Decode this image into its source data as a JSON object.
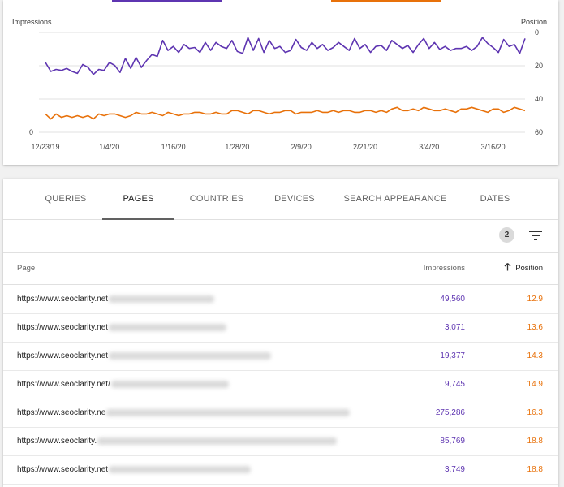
{
  "chart": {
    "left_axis_title": "Impressions",
    "right_axis_title": "Position",
    "left_ticks": [
      "0"
    ],
    "right_ticks": [
      "0",
      "20",
      "40",
      "60"
    ],
    "x_ticks": [
      "12/23/19",
      "1/4/20",
      "1/16/20",
      "1/28/20",
      "2/9/20",
      "2/21/20",
      "3/4/20",
      "3/16/20"
    ],
    "colors": {
      "impressions": "#5e35b1",
      "position": "#e8710a",
      "grid": "#e0e0e0"
    }
  },
  "chart_data": {
    "type": "line",
    "x": [
      "12/23/19",
      "12/24/19",
      "12/25/19",
      "12/26/19",
      "12/27/19",
      "12/28/19",
      "12/29/19",
      "12/30/19",
      "12/31/19",
      "1/1/20",
      "1/2/20",
      "1/3/20",
      "1/4/20",
      "1/5/20",
      "1/6/20",
      "1/7/20",
      "1/8/20",
      "1/9/20",
      "1/10/20",
      "1/11/20",
      "1/12/20",
      "1/13/20",
      "1/14/20",
      "1/15/20",
      "1/16/20",
      "1/17/20",
      "1/18/20",
      "1/19/20",
      "1/20/20",
      "1/21/20",
      "1/22/20",
      "1/23/20",
      "1/24/20",
      "1/25/20",
      "1/26/20",
      "1/27/20",
      "1/28/20",
      "1/29/20",
      "1/30/20",
      "1/31/20",
      "2/1/20",
      "2/2/20",
      "2/3/20",
      "2/4/20",
      "2/5/20",
      "2/6/20",
      "2/7/20",
      "2/8/20",
      "2/9/20",
      "2/10/20",
      "2/11/20",
      "2/12/20",
      "2/13/20",
      "2/14/20",
      "2/15/20",
      "2/16/20",
      "2/17/20",
      "2/18/20",
      "2/19/20",
      "2/20/20",
      "2/21/20",
      "2/22/20",
      "2/23/20",
      "2/24/20",
      "2/25/20",
      "2/26/20",
      "2/27/20",
      "2/28/20",
      "2/29/20",
      "3/1/20",
      "3/2/20",
      "3/3/20",
      "3/4/20",
      "3/5/20",
      "3/6/20",
      "3/7/20",
      "3/8/20",
      "3/9/20",
      "3/10/20",
      "3/11/20",
      "3/12/20",
      "3/13/20",
      "3/14/20",
      "3/15/20",
      "3/16/20",
      "3/17/20",
      "3/18/20",
      "3/19/20",
      "3/20/20",
      "3/21/20",
      "3/22/20"
    ],
    "series": [
      {
        "axis": "left",
        "color": "#5e35b1",
        "values": [
          70,
          61,
          63,
          62,
          64,
          61,
          59,
          68,
          65,
          58,
          63,
          62,
          70,
          67,
          60,
          74,
          64,
          75,
          65,
          72,
          78,
          76,
          92,
          82,
          86,
          80,
          88,
          84,
          85,
          80,
          90,
          82,
          90,
          86,
          84,
          92,
          81,
          79,
          95,
          82,
          94,
          80,
          92,
          84,
          86,
          80,
          82,
          93,
          85,
          82,
          90,
          84,
          88,
          82,
          85,
          90,
          86,
          82,
          94,
          84,
          88,
          80,
          86,
          87,
          82,
          92,
          88,
          84,
          87,
          80,
          88,
          94,
          84,
          90,
          83,
          86,
          82,
          84,
          84,
          86,
          82,
          86,
          95,
          89,
          85,
          80,
          93,
          86,
          88,
          79,
          94
        ]
      },
      {
        "axis": "right",
        "color": "#e8710a",
        "values": [
          49,
          52,
          49,
          51,
          50,
          51,
          50,
          51,
          50,
          52,
          49,
          50,
          49,
          49,
          50,
          51,
          50,
          48,
          49,
          49,
          48,
          49,
          50,
          48,
          49,
          50,
          49,
          49,
          48,
          48,
          49,
          49,
          48,
          49,
          49,
          47,
          47,
          48,
          49,
          47,
          47,
          48,
          49,
          48,
          48,
          47,
          47,
          49,
          48,
          48,
          48,
          47,
          48,
          48,
          47,
          48,
          47,
          47,
          48,
          48,
          47,
          47,
          48,
          47,
          48,
          46,
          45,
          47,
          47,
          46,
          47,
          45,
          46,
          47,
          47,
          46,
          47,
          48,
          46,
          46,
          45,
          46,
          47,
          48,
          46,
          46,
          48,
          47,
          45,
          46,
          47
        ]
      }
    ],
    "ylabel_left": "Impressions",
    "ylabel_right": "Position",
    "ylim_right": [
      0,
      60
    ],
    "right_axis_reversed": true,
    "grid": true
  },
  "tabs": [
    {
      "label": "QUERIES"
    },
    {
      "label": "PAGES"
    },
    {
      "label": "COUNTRIES"
    },
    {
      "label": "DEVICES"
    },
    {
      "label": "SEARCH APPEARANCE"
    },
    {
      "label": "DATES"
    }
  ],
  "active_tab": "PAGES",
  "filter": {
    "count": "2",
    "icon": "filter-list-icon"
  },
  "table": {
    "headers": {
      "page": "Page",
      "impressions": "Impressions",
      "position": "Position"
    },
    "sort_icon": "arrow-up-icon",
    "rows": [
      {
        "url": "https://www.seoclarity.net",
        "impressions": "49,560",
        "position": "12.9"
      },
      {
        "url": "https://www.seoclarity.net",
        "impressions": "3,071",
        "position": "13.6"
      },
      {
        "url": "https://www.seoclarity.net",
        "impressions": "19,377",
        "position": "14.3"
      },
      {
        "url": "https://www.seoclarity.net/",
        "impressions": "9,745",
        "position": "14.9"
      },
      {
        "url": "https://www.seoclarity.ne",
        "impressions": "275,286",
        "position": "16.3"
      },
      {
        "url": "https://www.seoclarity.",
        "impressions": "85,769",
        "position": "18.8"
      },
      {
        "url": "https://www.seoclarity.net",
        "impressions": "3,749",
        "position": "18.8"
      }
    ]
  }
}
